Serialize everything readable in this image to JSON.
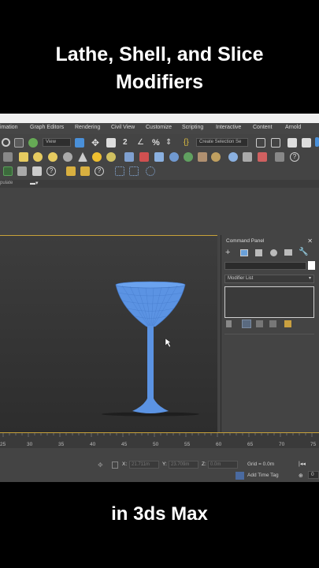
{
  "captions": {
    "top_line1": "Lathe, Shell, and Slice",
    "top_line2": "Modifiers",
    "bottom": "in 3ds Max"
  },
  "menu": {
    "items": [
      "imation",
      "Graph Editors",
      "Rendering",
      "Civil View",
      "Customize",
      "Scripting",
      "Interactive",
      "Content",
      "Arnold"
    ]
  },
  "toolbar": {
    "view_dropdown": "View",
    "selection_set_dropdown": "Create Selection Se",
    "percent_label": "%"
  },
  "subbar": {
    "label": "pulate"
  },
  "command_panel": {
    "title": "Command Panel",
    "close": "✕",
    "modifier_list": "Modifier List"
  },
  "timeline": {
    "ticks": [
      "25",
      "30",
      "35",
      "40",
      "45",
      "50",
      "55",
      "60",
      "65",
      "70",
      "75"
    ]
  },
  "status": {
    "x_label": "X:",
    "x_value": "21.711m",
    "y_label": "Y:",
    "y_value": "23.709m",
    "z_label": "Z:",
    "z_value": "0.0m",
    "grid": "Grid = 0.0m",
    "add_time_tag": "Add Time Tag",
    "frame_value": "0"
  },
  "colors": {
    "accent": "#c8a23a",
    "glass": "#5b93e3",
    "panel_bg": "#444444"
  }
}
